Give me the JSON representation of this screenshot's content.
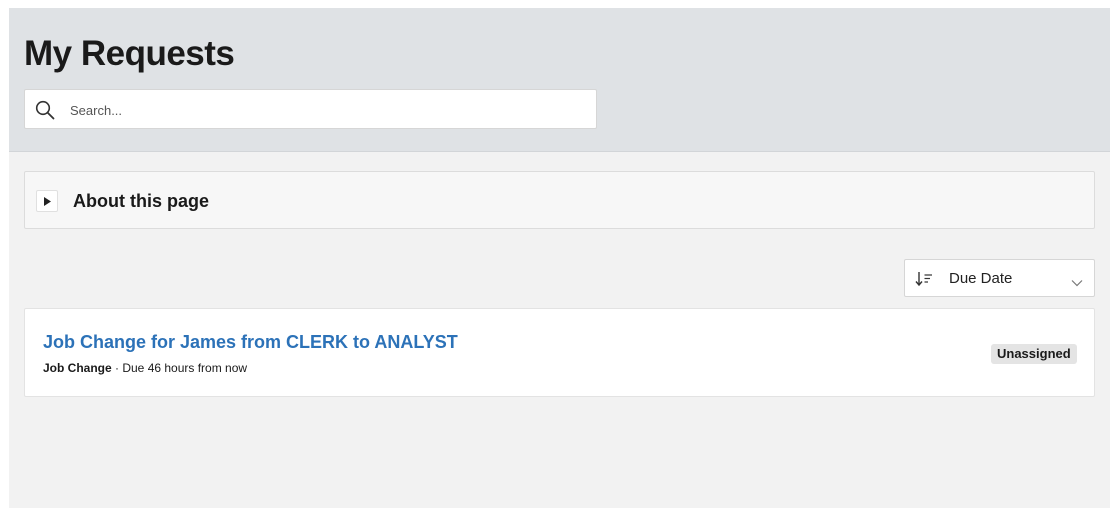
{
  "header": {
    "title": "My Requests",
    "search": {
      "placeholder": "Search...",
      "value": ""
    }
  },
  "about": {
    "title": "About this page",
    "expanded": false
  },
  "sort": {
    "selected": "Due Date"
  },
  "requests": [
    {
      "title": "Job Change for James from CLERK to ANALYST",
      "type": "Job Change",
      "separator": " · ",
      "due": "Due 46 hours from now",
      "status": "Unassigned"
    }
  ],
  "colors": {
    "header_bg": "#dfe2e5",
    "page_bg": "#f2f2f2",
    "link": "#2c72b8",
    "badge_bg": "#e4e4e4"
  },
  "icons": {
    "search": "search-icon",
    "about_toggle": "triangle-right-icon",
    "sort": "sort-descending-icon",
    "dropdown": "chevron-down-icon"
  }
}
